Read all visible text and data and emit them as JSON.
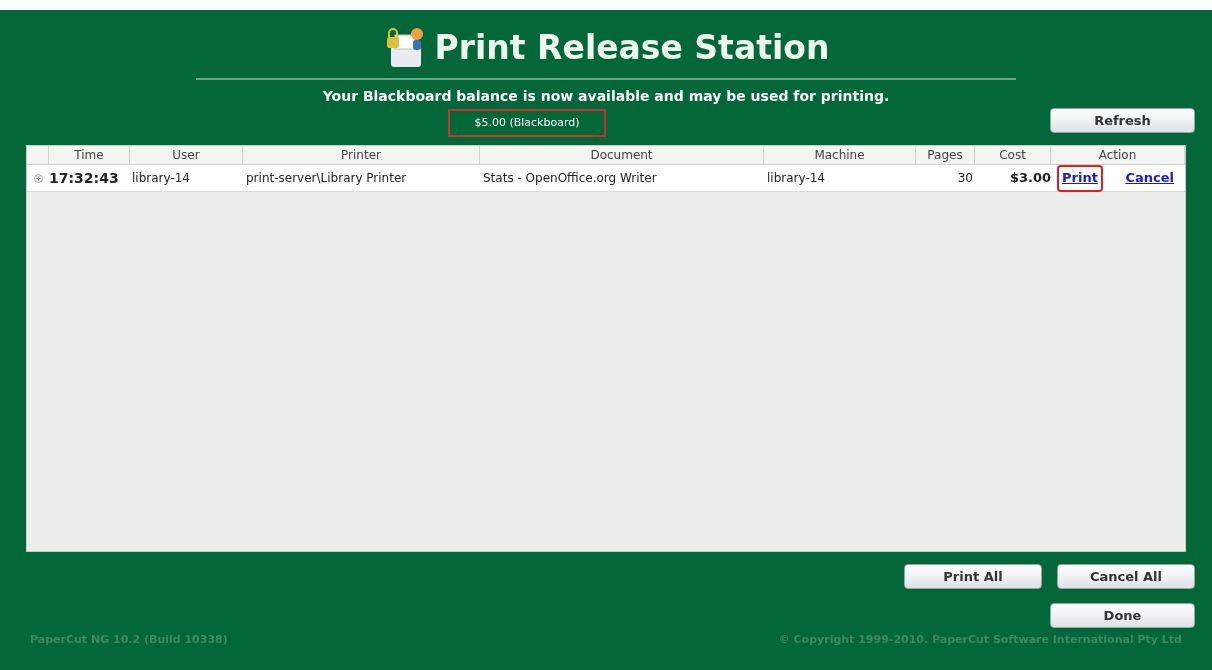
{
  "title": "Print Release Station",
  "message": "Your Blackboard balance is now available and may be used for printing.",
  "balance": {
    "text": "$5.00 (Blackboard)",
    "highlighted": true
  },
  "refresh_button": "Refresh",
  "table": {
    "columns": [
      "Time",
      "User",
      "Printer",
      "Document",
      "Machine",
      "Pages",
      "Cost",
      "Action"
    ],
    "rows": [
      {
        "time": "17:32:43",
        "user": "library-14",
        "printer": "print-server\\Library Printer",
        "document": "Stats - OpenOffice.org Writer",
        "machine": "library-14",
        "pages": "30",
        "cost": "$3.00",
        "actions": [
          {
            "label": "Print",
            "highlighted": true
          },
          {
            "label": "Cancel",
            "highlighted": false
          }
        ]
      }
    ]
  },
  "buttons": [
    "Print All",
    "Cancel All"
  ],
  "done_button": "Done",
  "version": "PaperCut NG 10.2 (Build 10338)",
  "copyright": "© Copyright 1999-2010. PaperCut Software International Pty Ltd"
}
